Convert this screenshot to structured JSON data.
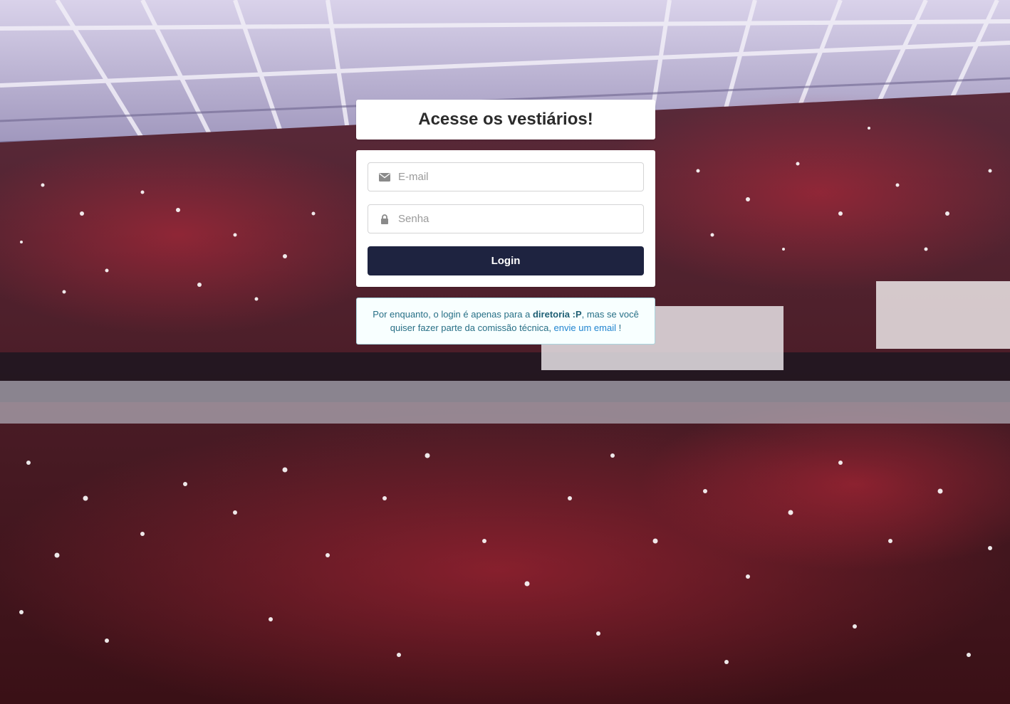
{
  "header": {
    "title": "Acesse os vestiários!"
  },
  "form": {
    "email": {
      "placeholder": "E-mail",
      "value": "",
      "icon": "envelope-icon"
    },
    "password": {
      "placeholder": "Senha",
      "value": "",
      "icon": "lock-icon"
    },
    "submit_label": "Login"
  },
  "message": {
    "text_before": "Por enquanto, o login é apenas para a ",
    "bold": "diretoria :P",
    "text_middle": ", mas se você quiser fazer parte da comissão técnica, ",
    "link": "envie um email",
    "text_after": " !"
  },
  "colors": {
    "button": "#1e2340",
    "message_bg": "#f8ffff",
    "message_border": "#a9d5de",
    "message_text": "#276f86",
    "link": "#2185d0"
  }
}
